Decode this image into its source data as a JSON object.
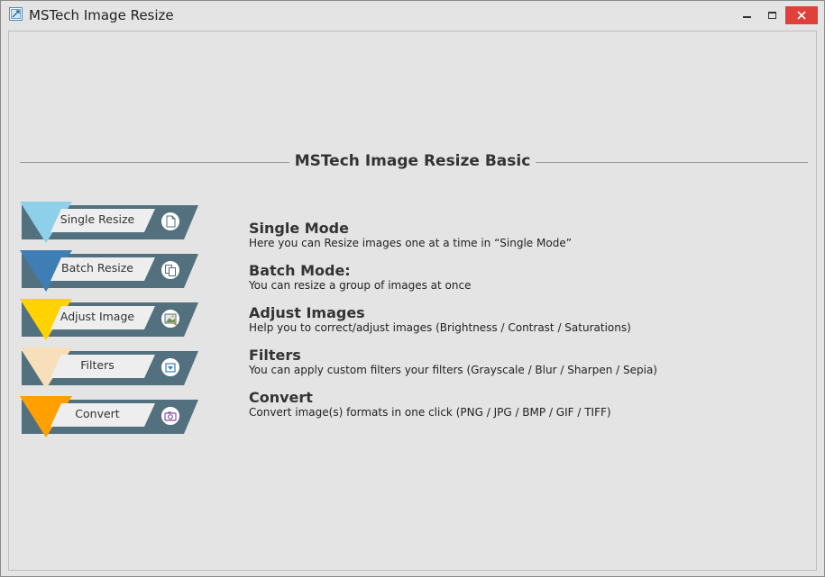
{
  "window": {
    "title": "MSTech Image Resize"
  },
  "heading": "MSTech Image Resize Basic",
  "menu": [
    {
      "label": "Single Resize",
      "accent": "#8ed0ea",
      "icon": "single-page-icon"
    },
    {
      "label": "Batch Resize",
      "accent": "#3f7db5",
      "icon": "multi-page-icon"
    },
    {
      "label": "Adjust Image",
      "accent": "#ffd200",
      "icon": "picture-adjust-icon"
    },
    {
      "label": "Filters",
      "accent": "#f6dfba",
      "icon": "filter-icon"
    },
    {
      "label": "Convert",
      "accent": "#ff9f00",
      "icon": "camera-icon"
    }
  ],
  "descriptions": [
    {
      "title": "Single Mode",
      "text": "Here you can Resize images one at a time in “Single Mode”"
    },
    {
      "title": "Batch Mode:",
      "text": "You can resize a group of images at once"
    },
    {
      "title": "Adjust Images",
      "text": "Help you to correct/adjust images (Brightness / Contrast / Saturations)"
    },
    {
      "title": "Filters",
      "text": "You can apply custom filters your filters (Grayscale / Blur / Sharpen / Sepia)"
    },
    {
      "title": "Convert",
      "text": "Convert image(s) formats in one click (PNG / JPG / BMP / GIF / TIFF)"
    }
  ],
  "colors": {
    "band": "#52707d",
    "label_bg": "#eeeeee",
    "close_button": "#e0403a"
  }
}
